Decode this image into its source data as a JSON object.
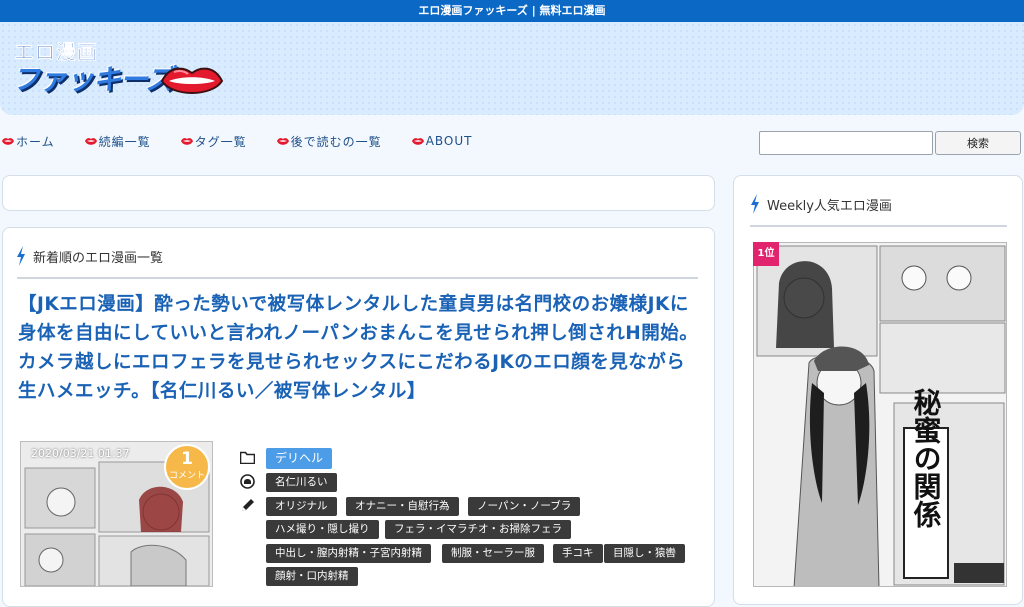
{
  "site": {
    "top_text": "エロ漫画ファッキーズ | 無料エロ漫画",
    "logo_small": "エロ漫画",
    "logo_big": "ファッキーズ"
  },
  "nav": {
    "items": [
      {
        "label": "ホーム",
        "icon": "lips-icon"
      },
      {
        "label": "続編一覧",
        "icon": "lips-icon"
      },
      {
        "label": "タグ一覧",
        "icon": "lips-icon"
      },
      {
        "label": "後で読むの一覧",
        "icon": "lips-icon"
      },
      {
        "label": "ABOUT",
        "icon": "lips-icon"
      }
    ]
  },
  "search": {
    "value": "",
    "placeholder": "",
    "button_label": "検索"
  },
  "main": {
    "section_title": "新着順のエロ漫画一覧",
    "post": {
      "title": "【JKエロ漫画】酔った勢いで被写体レンタルした童貞男は名門校のお嬢様JKに身体を自由にしていいと言われノーパンおまんこを見せられ押し倒されH開始。カメラ越しにエロフェラを見せられセックスにこだわるJKのエロ顔を見ながら生ハメエッチ。【名仁川るい／被写体レンタル】",
      "date": "2020/03/21 01:37",
      "comment_count": "1",
      "comment_label": "コメント",
      "category": "デリヘル",
      "author": "名仁川るい",
      "tags": [
        "オリジナル",
        "オナニー・自慰行為",
        "ノーパン・ノーブラ",
        "ハメ撮り・隠し撮り",
        "フェラ・イマラチオ・お掃除フェラ",
        "中出し・膣内射精・子宮内射精",
        "制服・セーラー服",
        "手コキ",
        "目隠し・猿轡",
        "顔射・口内射精"
      ]
    }
  },
  "sidebar": {
    "section_title": "Weekly人気エロ漫画",
    "rank_label": "1位",
    "cover_title": "秘蜜の関係"
  },
  "colors": {
    "topbar": "#0b68c4",
    "title_link": "#1a62b5",
    "category_tag": "#4d9ce8",
    "tag": "#3a3a3a",
    "rank_badge": "#e2246e",
    "comment_badge": "#f7b84a"
  }
}
